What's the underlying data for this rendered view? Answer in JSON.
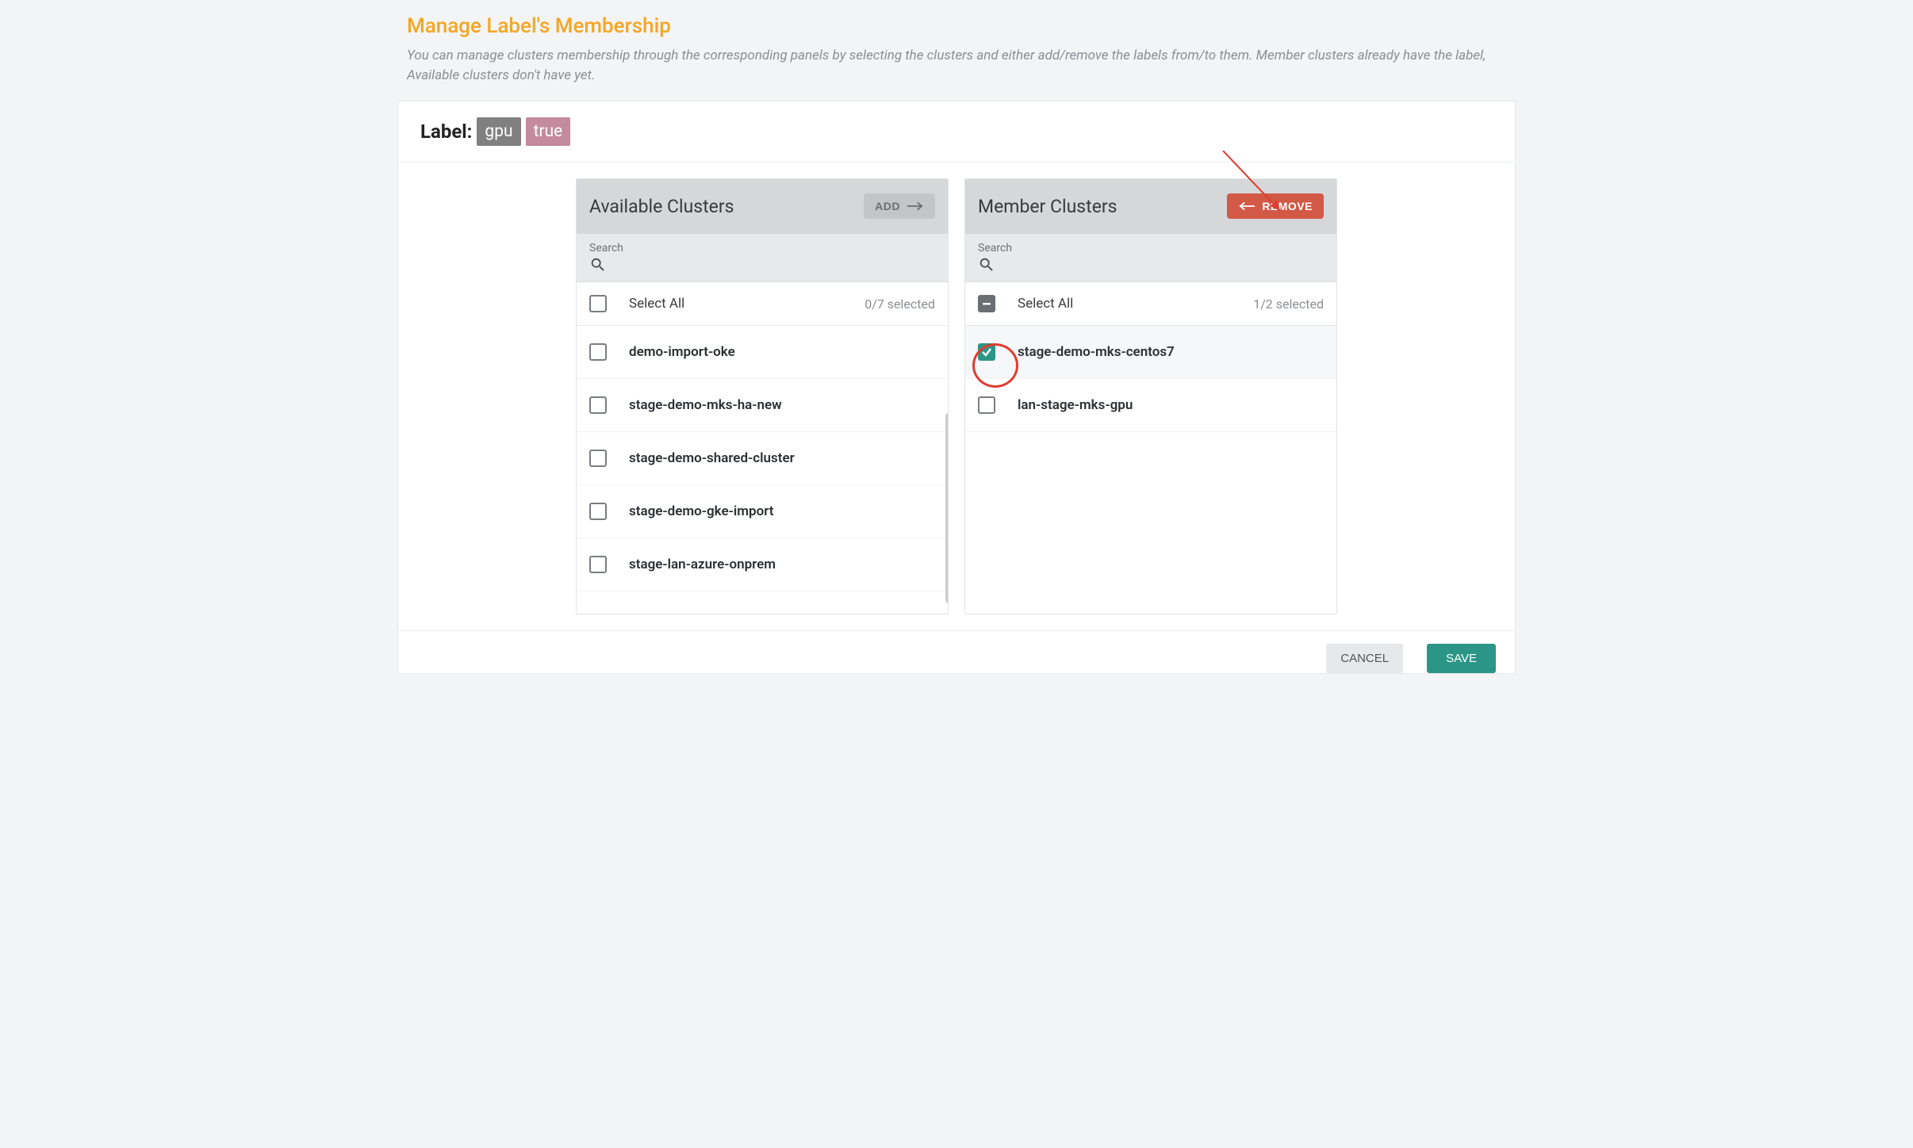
{
  "header": {
    "title": "Manage Label's Membership",
    "description": "You can manage clusters membership through the corresponding panels by selecting the clusters and either add/remove the labels from/to them. Member clusters already have the label, Available clusters don't have yet."
  },
  "label": {
    "prefix": "Label:",
    "key": "gpu",
    "value": "true"
  },
  "available": {
    "title": "Available Clusters",
    "add_label": "ADD",
    "search_label": "Search",
    "select_all": "Select All",
    "selected_count": "0/7 selected",
    "items": [
      {
        "name": "demo-import-oke",
        "checked": false
      },
      {
        "name": "stage-demo-mks-ha-new",
        "checked": false
      },
      {
        "name": "stage-demo-shared-cluster",
        "checked": false
      },
      {
        "name": "stage-demo-gke-import",
        "checked": false
      },
      {
        "name": "stage-lan-azure-onprem",
        "checked": false
      }
    ]
  },
  "member": {
    "title": "Member Clusters",
    "remove_label": "REMOVE",
    "search_label": "Search",
    "select_all": "Select All",
    "selected_count": "1/2 selected",
    "items": [
      {
        "name": "stage-demo-mks-centos7",
        "checked": true
      },
      {
        "name": "lan-stage-mks-gpu",
        "checked": false
      }
    ]
  },
  "footer": {
    "cancel": "CANCEL",
    "save": "SAVE"
  }
}
